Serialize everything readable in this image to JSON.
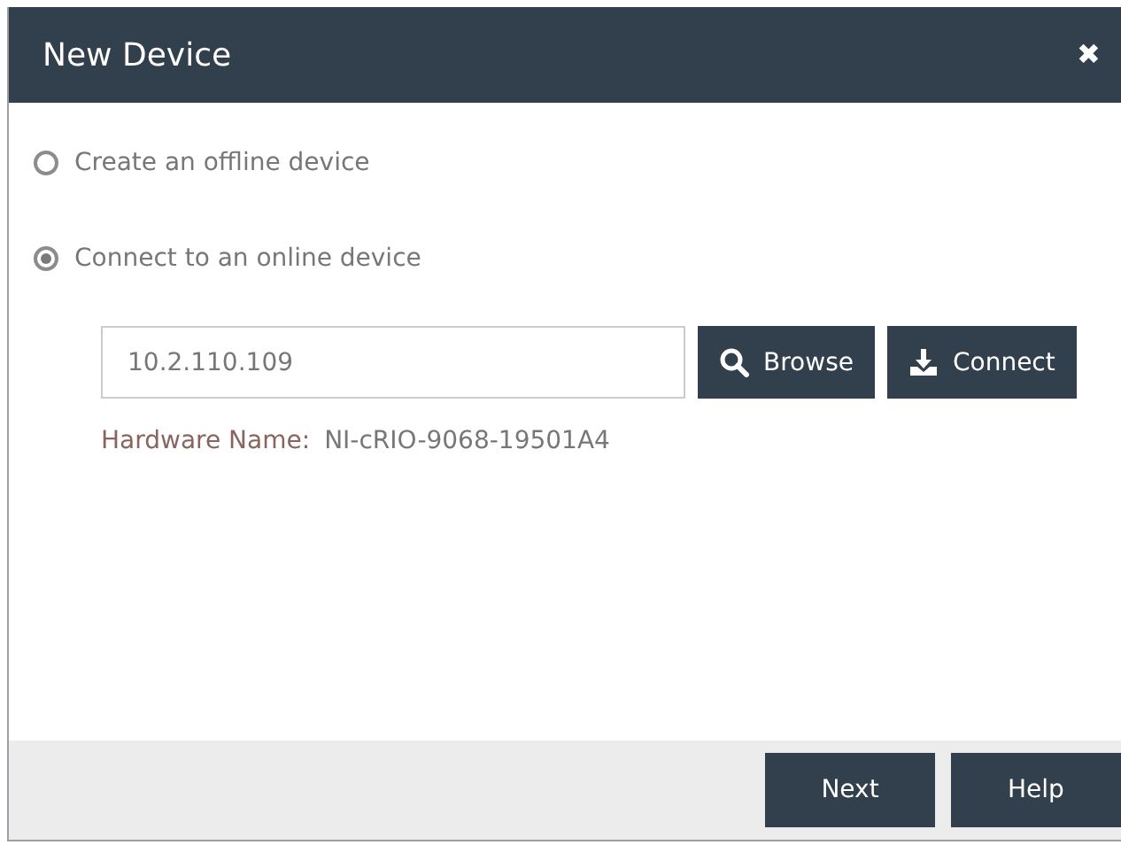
{
  "dialog": {
    "title": "New Device",
    "close": "✖"
  },
  "options": [
    {
      "label": "Create an offline device",
      "selected": false
    },
    {
      "label": "Connect to an online device",
      "selected": true
    }
  ],
  "address": {
    "value": "10.2.110.109"
  },
  "buttons": [
    {
      "kind": "browse",
      "label": "Browse"
    },
    {
      "kind": "connect",
      "label": "Connect"
    }
  ],
  "hardware": {
    "label": "Hardware Name:",
    "value": "NI-cRIO-9068-19501A4"
  },
  "footer_buttons": [
    {
      "label": "Next"
    },
    {
      "label": "Help"
    }
  ]
}
